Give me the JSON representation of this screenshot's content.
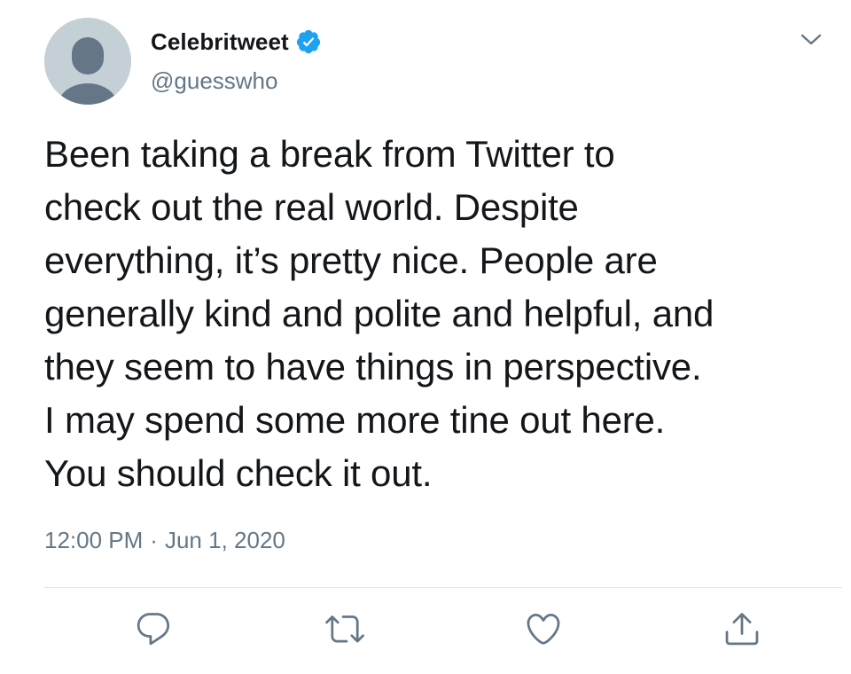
{
  "tweet": {
    "display_name": "Celebritweet",
    "handle": "@guesswho",
    "verified": true,
    "text": "Been taking a break from Twitter to\ncheck out the real world. Despite\neverything, it’s pretty nice. People are\ngenerally kind and polite and helpful, and\nthey seem to have things in perspective.\nI may spend some more tine out here.\nYou should check it out.",
    "time": "12:00 PM",
    "separator": "·",
    "date": "Jun 1, 2020"
  },
  "icons": {
    "avatar": "default-avatar-silhouette",
    "verified": "verified-badge-icon",
    "caret": "chevron-down-icon",
    "reply": "reply-icon",
    "retweet": "retweet-icon",
    "like": "heart-icon",
    "share": "share-icon"
  },
  "colors": {
    "text": "#14171a",
    "secondary": "#657786",
    "verified_blue": "#1da1f2",
    "avatar_bg": "#c4cfd6",
    "avatar_figure": "#657786",
    "divider": "#e1e8ed"
  }
}
